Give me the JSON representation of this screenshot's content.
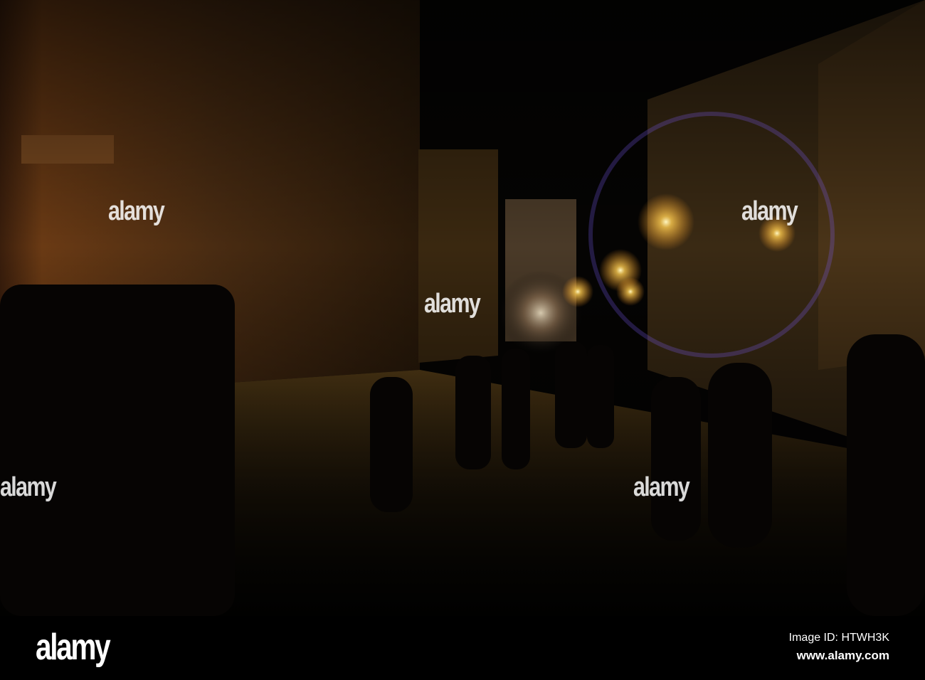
{
  "photo": {
    "subject": "Night street scene",
    "watermark_text": "alamy",
    "watermark_mark": "a"
  },
  "footer": {
    "logo": "alamy",
    "image_id": "Image ID: HTWH3K",
    "url": "www.alamy.com"
  }
}
